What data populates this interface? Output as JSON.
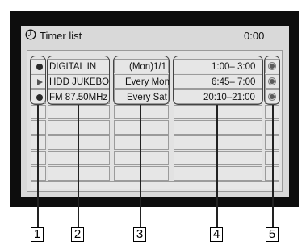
{
  "header": {
    "title": "Timer list",
    "time": "0:00",
    "title_icon": "clock-icon"
  },
  "timers": [
    {
      "status_marker": "record-dot",
      "source": "DIGITAL IN",
      "date": "(Mon)1/1",
      "time": "1:00– 3:00",
      "end_marker": "circle"
    },
    {
      "status_marker": "play-triangle",
      "source": "HDD JUKEBO",
      "date": "Every Mon",
      "time": "6:45– 7:00",
      "end_marker": "circle"
    },
    {
      "status_marker": "record-dot",
      "source": "FM 87.50MHz",
      "date": "Every Sat",
      "time": "20:10–21:00",
      "end_marker": "circle"
    }
  ],
  "callouts": [
    "1",
    "2",
    "3",
    "4",
    "5"
  ],
  "colors": {
    "screen": "#0d0d0d",
    "panel": "#d9d9d9",
    "cell": "#e6e6e6",
    "group_outline": "#444444"
  }
}
